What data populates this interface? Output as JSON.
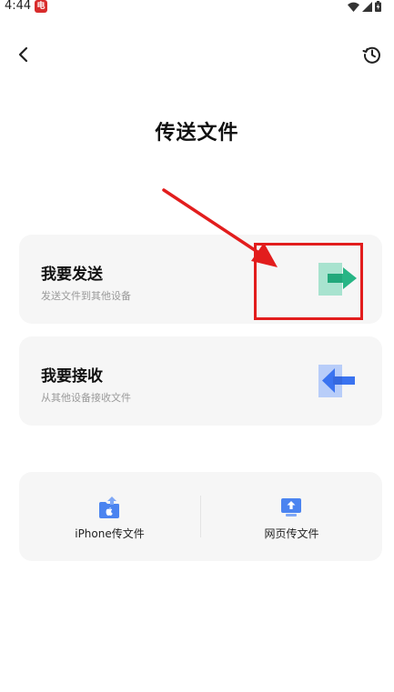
{
  "status_bar": {
    "time": "4:44",
    "badge": "电"
  },
  "page": {
    "title": "传送文件"
  },
  "send_card": {
    "title": "我要发送",
    "subtitle": "发送文件到其他设备",
    "icon": "send-arrow-icon"
  },
  "receive_card": {
    "title": "我要接收",
    "subtitle": "从其他设备接收文件",
    "icon": "receive-arrow-icon"
  },
  "tools": {
    "iphone_label": "iPhone传文件",
    "web_label": "网页传文件"
  },
  "colors": {
    "accent_red": "#e21d1d",
    "send_green": "#27b585",
    "receive_blue": "#3a73f0",
    "card_bg": "#f6f6f6"
  }
}
